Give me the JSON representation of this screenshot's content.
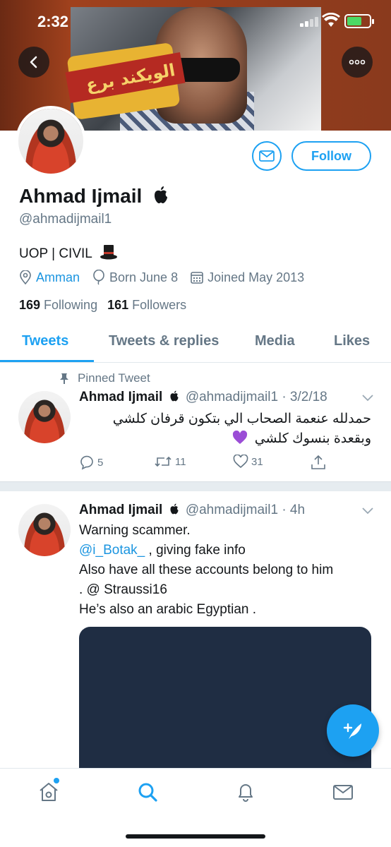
{
  "status_bar": {
    "time": "2:32"
  },
  "banner": {
    "ribbon_text": "الويكند برع"
  },
  "profile": {
    "name": "Ahmad Ijmail",
    "handle": "@ahmadijmail1",
    "bio": "UOP | CIVIL",
    "location": "Amman",
    "birthday": "Born June 8",
    "joined": "Joined May 2013",
    "following_count": "169",
    "following_label": "Following",
    "followers_count": "161",
    "followers_label": "Followers",
    "follow_label": "Follow"
  },
  "tabs": [
    "Tweets",
    "Tweets & replies",
    "Media",
    "Likes"
  ],
  "tweets": [
    {
      "pinned_label": "Pinned Tweet",
      "name": "Ahmad Ijmail",
      "handle_time": "@ahmadijmail1 · 3/2/18",
      "text_line1": "حمدلله عنعمة الصحاب الي بتكون قرفان كلشي",
      "text_line2": "وبقعدة بنسوك كلشي",
      "replies": "5",
      "retweets": "11",
      "likes": "31"
    },
    {
      "name": "Ahmad Ijmail",
      "handle_time": "@ahmadijmail1 · 4h",
      "line1": "Warning scammer.",
      "mention": "@i_Botak_",
      "line2_rest": " , giving fake info",
      "line3": "Also have all these accounts belong to him",
      "line4": ". @ Straussi16",
      "line5": "He’s also an arabic Egyptian ."
    }
  ],
  "colors": {
    "accent": "#1da1f2",
    "link": "#1b95e0",
    "secondary_text": "#657786",
    "media_bg": "#1f2d43",
    "purple_heart": "#9b4dd6"
  }
}
